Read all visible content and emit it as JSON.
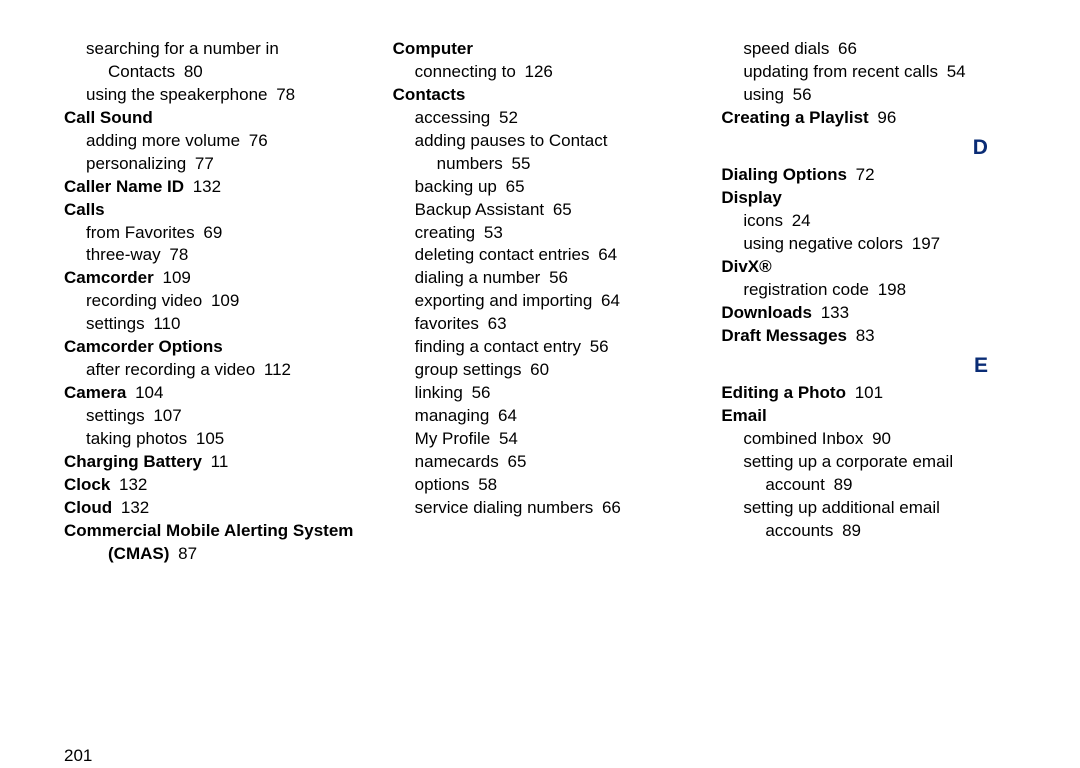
{
  "page_number": "201",
  "entries": [
    {
      "type": "row",
      "indent": 1,
      "bold": false,
      "text": "searching for a number in"
    },
    {
      "type": "row",
      "indent": 2,
      "bold": false,
      "text": "Contacts",
      "page": "80"
    },
    {
      "type": "row",
      "indent": 1,
      "bold": false,
      "text": "using the speakerphone",
      "page": "78"
    },
    {
      "type": "row",
      "indent": 0,
      "bold": true,
      "text": "Call Sound"
    },
    {
      "type": "row",
      "indent": 1,
      "bold": false,
      "text": "adding more volume",
      "page": "76"
    },
    {
      "type": "row",
      "indent": 1,
      "bold": false,
      "text": "personalizing",
      "page": "77"
    },
    {
      "type": "row",
      "indent": 0,
      "bold": true,
      "text": "Caller Name ID",
      "page": "132"
    },
    {
      "type": "row",
      "indent": 0,
      "bold": true,
      "text": "Calls"
    },
    {
      "type": "row",
      "indent": 1,
      "bold": false,
      "text": "from Favorites",
      "page": "69"
    },
    {
      "type": "row",
      "indent": 1,
      "bold": false,
      "text": "three-way",
      "page": "78"
    },
    {
      "type": "row",
      "indent": 0,
      "bold": true,
      "text": "Camcorder",
      "page": "109"
    },
    {
      "type": "row",
      "indent": 1,
      "bold": false,
      "text": "recording video",
      "page": "109"
    },
    {
      "type": "row",
      "indent": 1,
      "bold": false,
      "text": "settings",
      "page": "110"
    },
    {
      "type": "row",
      "indent": 0,
      "bold": true,
      "text": "Camcorder Options"
    },
    {
      "type": "row",
      "indent": 1,
      "bold": false,
      "text": "after recording a video",
      "page": "112"
    },
    {
      "type": "row",
      "indent": 0,
      "bold": true,
      "text": "Camera",
      "page": "104"
    },
    {
      "type": "row",
      "indent": 1,
      "bold": false,
      "text": "settings",
      "page": "107"
    },
    {
      "type": "row",
      "indent": 1,
      "bold": false,
      "text": "taking photos",
      "page": "105"
    },
    {
      "type": "row",
      "indent": 0,
      "bold": true,
      "text": "Charging Battery",
      "page": "11"
    },
    {
      "type": "row",
      "indent": 0,
      "bold": true,
      "text": "Clock",
      "page": "132"
    },
    {
      "type": "row",
      "indent": 0,
      "bold": true,
      "text": "Cloud",
      "page": "132"
    },
    {
      "type": "row",
      "indent": 0,
      "bold": true,
      "text": "Commercial Mobile Alerting System"
    },
    {
      "type": "row",
      "indent": 2,
      "bold": true,
      "text": "(CMAS)",
      "page": "87"
    },
    {
      "type": "break"
    },
    {
      "type": "row",
      "indent": 0,
      "bold": true,
      "text": "Computer"
    },
    {
      "type": "row",
      "indent": 1,
      "bold": false,
      "text": "connecting to",
      "page": "126"
    },
    {
      "type": "row",
      "indent": 0,
      "bold": true,
      "text": "Contacts"
    },
    {
      "type": "row",
      "indent": 1,
      "bold": false,
      "text": "accessing",
      "page": "52"
    },
    {
      "type": "row",
      "indent": 1,
      "bold": false,
      "text": "adding pauses to Contact"
    },
    {
      "type": "row",
      "indent": 2,
      "bold": false,
      "text": "numbers",
      "page": "55"
    },
    {
      "type": "row",
      "indent": 1,
      "bold": false,
      "text": "backing up",
      "page": "65"
    },
    {
      "type": "row",
      "indent": 1,
      "bold": false,
      "text": "Backup Assistant",
      "page": "65"
    },
    {
      "type": "row",
      "indent": 1,
      "bold": false,
      "text": "creating",
      "page": "53"
    },
    {
      "type": "row",
      "indent": 1,
      "bold": false,
      "text": "deleting contact entries",
      "page": "64"
    },
    {
      "type": "row",
      "indent": 1,
      "bold": false,
      "text": "dialing a number",
      "page": "56"
    },
    {
      "type": "row",
      "indent": 1,
      "bold": false,
      "text": "exporting and importing",
      "page": "64"
    },
    {
      "type": "row",
      "indent": 1,
      "bold": false,
      "text": "favorites",
      "page": "63"
    },
    {
      "type": "row",
      "indent": 1,
      "bold": false,
      "text": "finding a contact entry",
      "page": "56"
    },
    {
      "type": "row",
      "indent": 1,
      "bold": false,
      "text": "group settings",
      "page": "60"
    },
    {
      "type": "row",
      "indent": 1,
      "bold": false,
      "text": "linking",
      "page": "56"
    },
    {
      "type": "row",
      "indent": 1,
      "bold": false,
      "text": "managing",
      "page": "64"
    },
    {
      "type": "row",
      "indent": 1,
      "bold": false,
      "text": "My Profile",
      "page": "54"
    },
    {
      "type": "row",
      "indent": 1,
      "bold": false,
      "text": "namecards",
      "page": "65"
    },
    {
      "type": "row",
      "indent": 1,
      "bold": false,
      "text": "options",
      "page": "58"
    },
    {
      "type": "row",
      "indent": 1,
      "bold": false,
      "text": "service dialing numbers",
      "page": "66"
    },
    {
      "type": "break"
    },
    {
      "type": "row",
      "indent": 1,
      "bold": false,
      "text": "speed dials",
      "page": "66"
    },
    {
      "type": "row",
      "indent": 1,
      "bold": false,
      "text": "updating from recent calls",
      "page": "54"
    },
    {
      "type": "row",
      "indent": 1,
      "bold": false,
      "text": "using",
      "page": "56"
    },
    {
      "type": "row",
      "indent": 0,
      "bold": true,
      "text": "Creating a Playlist",
      "page": "96"
    },
    {
      "type": "section",
      "letter": "D"
    },
    {
      "type": "row",
      "indent": 0,
      "bold": true,
      "text": "Dialing Options",
      "page": "72"
    },
    {
      "type": "row",
      "indent": 0,
      "bold": true,
      "text": "Display"
    },
    {
      "type": "row",
      "indent": 1,
      "bold": false,
      "text": "icons",
      "page": "24"
    },
    {
      "type": "row",
      "indent": 1,
      "bold": false,
      "text": "using negative colors",
      "page": "197"
    },
    {
      "type": "row",
      "indent": 0,
      "bold": true,
      "text": "DivX®"
    },
    {
      "type": "row",
      "indent": 1,
      "bold": false,
      "text": "registration code",
      "page": "198"
    },
    {
      "type": "row",
      "indent": 0,
      "bold": true,
      "text": "Downloads",
      "page": "133"
    },
    {
      "type": "row",
      "indent": 0,
      "bold": true,
      "text": "Draft Messages",
      "page": "83"
    },
    {
      "type": "section",
      "letter": "E"
    },
    {
      "type": "row",
      "indent": 0,
      "bold": true,
      "text": "Editing a Photo",
      "page": "101"
    },
    {
      "type": "row",
      "indent": 0,
      "bold": true,
      "text": "Email"
    },
    {
      "type": "row",
      "indent": 1,
      "bold": false,
      "text": "combined Inbox",
      "page": "90"
    },
    {
      "type": "row",
      "indent": 1,
      "bold": false,
      "text": "setting up a corporate email"
    },
    {
      "type": "row",
      "indent": 2,
      "bold": false,
      "text": "account",
      "page": "89"
    },
    {
      "type": "row",
      "indent": 1,
      "bold": false,
      "text": "setting up additional email"
    },
    {
      "type": "row",
      "indent": 2,
      "bold": false,
      "text": "accounts",
      "page": "89"
    }
  ]
}
